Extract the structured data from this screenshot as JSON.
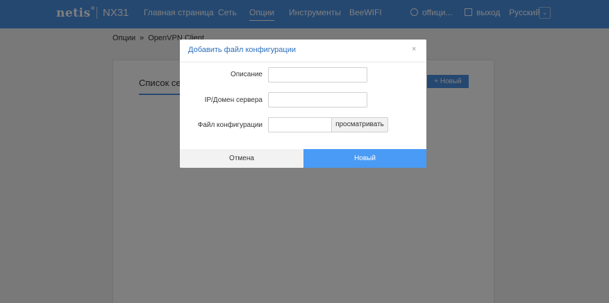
{
  "header": {
    "brand": "netis",
    "model": "NX31",
    "nav": [
      {
        "label": "Главная страница"
      },
      {
        "label": "Сеть"
      },
      {
        "label": "Опции"
      },
      {
        "label": "Инструменты"
      },
      {
        "label": "BeeWIFI"
      }
    ],
    "active_nav": "Опции",
    "official_label": "offици...",
    "logout_label": "выход",
    "language": "Русский"
  },
  "breadcrumb": {
    "root": "Опции",
    "separator": "»",
    "current": "OpenVPN Client"
  },
  "panel": {
    "tab_label": "Список серверов",
    "new_button_label": "+ Новый"
  },
  "modal": {
    "title": "Добавить файл конфигурации",
    "close_symbol": "×",
    "fields": {
      "description_label": "Описание",
      "description_value": "",
      "server_label": "IP/Домен сервера",
      "server_value": "",
      "config_label": "Файл конфигурации",
      "browse_label": "просматривать"
    },
    "cancel_label": "Отмена",
    "submit_label": "Новый"
  },
  "colors": {
    "topbar": "#4a90e2",
    "primary_button": "#4a9bf5",
    "title_text": "#2a6ebb"
  }
}
